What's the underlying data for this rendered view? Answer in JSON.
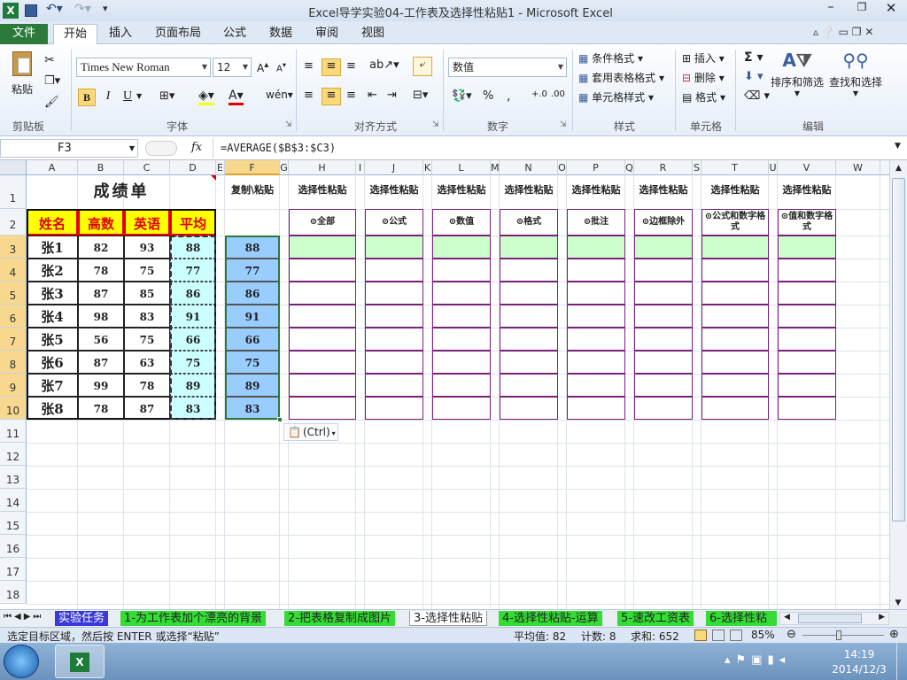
{
  "title": {
    "text": "Excel导学实验04-工作表及选择性粘贴1  -  Microsoft Excel"
  },
  "tabs": {
    "file": "文件",
    "home": "开始",
    "insert": "插入",
    "layout": "页面布局",
    "formula": "公式",
    "data": "数据",
    "review": "审阅",
    "view": "视图"
  },
  "ribbon": {
    "paste": "粘贴",
    "clipboard": "剪贴板",
    "font_group": "字体",
    "font_name": "Times New Roman",
    "font_size": "12",
    "bold": "B",
    "italic": "I",
    "underline": "U",
    "align_group": "对齐方式",
    "number_format": "数值",
    "number_group": "数字",
    "cond_format": "条件格式",
    "table_format": "套用表格格式",
    "cell_style": "单元格样式",
    "styles_group": "样式",
    "insert": "插入",
    "delete": "删除",
    "format": "格式",
    "cells_group": "单元格",
    "sort": "排序和筛选",
    "find": "查找和选择",
    "edit_group": "编辑"
  },
  "formula_bar": {
    "name_box": "F3",
    "fx": "fx",
    "formula": "=AVERAGE($B$3:$C3)"
  },
  "columns": [
    "A",
    "B",
    "C",
    "D",
    "E",
    "F",
    "G",
    "H",
    "I",
    "J",
    "K",
    "L",
    "M",
    "N",
    "O",
    "P",
    "Q",
    "R",
    "S",
    "T",
    "U",
    "V",
    "W"
  ],
  "rows": [
    "1",
    "2",
    "3",
    "4",
    "5",
    "6",
    "7",
    "8",
    "9",
    "10",
    "11",
    "12",
    "13",
    "14",
    "15",
    "16",
    "17",
    "18"
  ],
  "sheet": {
    "title": "成绩单",
    "headers": [
      "姓名",
      "高数",
      "英语",
      "平均"
    ],
    "names": [
      "张1",
      "张2",
      "张3",
      "张4",
      "张5",
      "张6",
      "张7",
      "张8"
    ],
    "gaoshu": [
      "82",
      "78",
      "87",
      "98",
      "56",
      "87",
      "99",
      "78"
    ],
    "english": [
      "93",
      "75",
      "85",
      "83",
      "75",
      "63",
      "78",
      "87"
    ],
    "avg": [
      "88",
      "77",
      "86",
      "91",
      "66",
      "75",
      "89",
      "83"
    ],
    "copy_header": "复制\\粘贴",
    "copied": [
      "88",
      "77",
      "86",
      "91",
      "66",
      "75",
      "89",
      "83"
    ],
    "paste_headers": [
      "选择性粘贴",
      "选择性粘贴",
      "选择性粘贴",
      "选择性粘贴",
      "选择性粘贴",
      "选择性粘贴",
      "选择性粘贴",
      "选择性粘贴"
    ],
    "paste_options": [
      "⊙全部",
      "⊙公式",
      "⊙数值",
      "⊙格式",
      "⊙批注",
      "⊙边框除外",
      "⊙公式和数字格式",
      "⊙值和数字格式"
    ],
    "ctrl_popup": "(Ctrl)"
  },
  "sheet_tabs": [
    "实验任务",
    "1-为工作表加个漂亮的背景",
    "2-把表格复制成图片",
    "3-选择性粘贴",
    "4-选择性粘贴-运算",
    "5-速改工资表",
    "6-选择性粘"
  ],
  "status": {
    "hint": "选定目标区域，然后按 ENTER 或选择“粘贴”",
    "average": "平均值: 82",
    "count": "计数: 8",
    "sum": "求和: 652",
    "zoom": "85%"
  },
  "taskbar": {
    "time": "14:19",
    "date": "2014/12/3"
  },
  "colors": {
    "header_yellow": "#ffff00",
    "header_border": "#e00000",
    "paste_green": "#ccffcc",
    "copy_blue": "#99ccff",
    "avg_cyan": "#ccffff",
    "accent": "#2b7a3a"
  }
}
